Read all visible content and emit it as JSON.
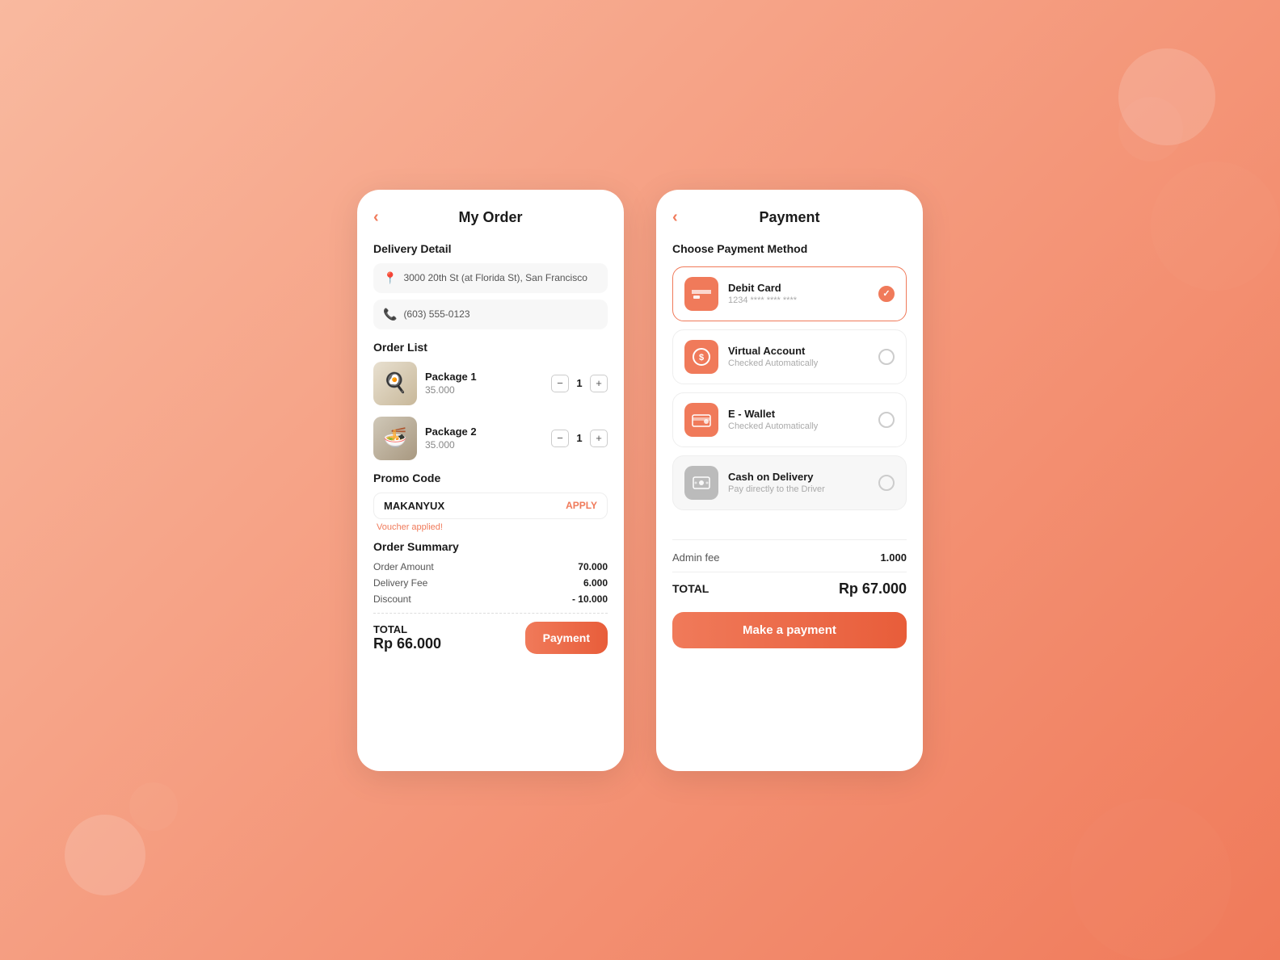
{
  "myOrder": {
    "title": "My Order",
    "back": "‹",
    "deliveryDetail": {
      "sectionTitle": "Delivery Detail",
      "address": "3000 20th St (at Florida St), San Francisco",
      "phone": "(603) 555-0123"
    },
    "orderList": {
      "sectionTitle": "Order List",
      "items": [
        {
          "name": "Package 1",
          "price": "35.000",
          "qty": "1",
          "emoji": "🍳"
        },
        {
          "name": "Package 2",
          "price": "35.000",
          "qty": "1",
          "emoji": "🍜"
        }
      ]
    },
    "promoCode": {
      "sectionTitle": "Promo Code",
      "code": "MAKANYUX",
      "applyLabel": "APPLY",
      "voucherMessage": "Voucher applied!"
    },
    "orderSummary": {
      "sectionTitle": "Order Summary",
      "rows": [
        {
          "label": "Order Amount",
          "value": "70.000"
        },
        {
          "label": "Delivery Fee",
          "value": "6.000"
        },
        {
          "label": "Discount",
          "value": "- 10.000"
        }
      ],
      "totalLabel": "TOTAL",
      "totalAmount": "Rp 66.000"
    },
    "paymentButton": "Payment"
  },
  "payment": {
    "title": "Payment",
    "back": "‹",
    "chooseMethodTitle": "Choose Payment Method",
    "methods": [
      {
        "name": "Debit Card",
        "sub": "1234 **** **** ****",
        "iconType": "debit",
        "selected": true,
        "disabled": false
      },
      {
        "name": "Virtual Account",
        "sub": "Checked Automatically",
        "iconType": "virtual",
        "selected": false,
        "disabled": false
      },
      {
        "name": "E - Wallet",
        "sub": "Checked Automatically",
        "iconType": "ewallet",
        "selected": false,
        "disabled": false
      },
      {
        "name": "Cash on Delivery",
        "sub": "Pay directly to the Driver",
        "iconType": "cash",
        "selected": false,
        "disabled": true
      }
    ],
    "adminFeeLabel": "Admin fee",
    "adminFeeValue": "1.000",
    "totalLabel": "TOTAL",
    "totalAmount": "Rp 67.000",
    "makePaymentButton": "Make a payment"
  }
}
